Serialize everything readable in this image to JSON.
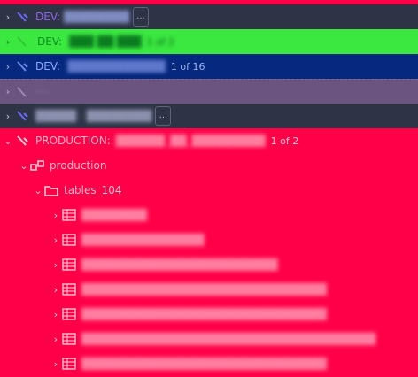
{
  "colors": {
    "dev1_bg": "#2e3446",
    "dev2_bg": "#3ae840",
    "dev3_bg": "#06287e",
    "row4_bg": "#6b5480",
    "row5_bg": "#2e3446",
    "production_bg": "#ff0048"
  },
  "tree": {
    "dev1": {
      "label": "DEV:",
      "name": "████████",
      "more": "..."
    },
    "dev2": {
      "label": "DEV:",
      "name": "███ ██ ███",
      "count": "1 of 2"
    },
    "dev3": {
      "label": "DEV:",
      "name": "████████████",
      "count": "1 of 16"
    },
    "row4": {
      "label": "····",
      "name": "",
      "count": ""
    },
    "row5": {
      "name": "█████ · ████████",
      "more": "..."
    },
    "production": {
      "label": "PRODUCTION:",
      "name": "██████_██_█████████",
      "count": "1 of 2",
      "schema": "production",
      "tables_label": "tables",
      "tables_count": "104",
      "tables": [
        "████████",
        "███████████████",
        "████████████████████████",
        "██████████████████████████████",
        "██████████████████████████████",
        "████████████████████████████████████",
        "██████████████████████████████"
      ]
    }
  }
}
